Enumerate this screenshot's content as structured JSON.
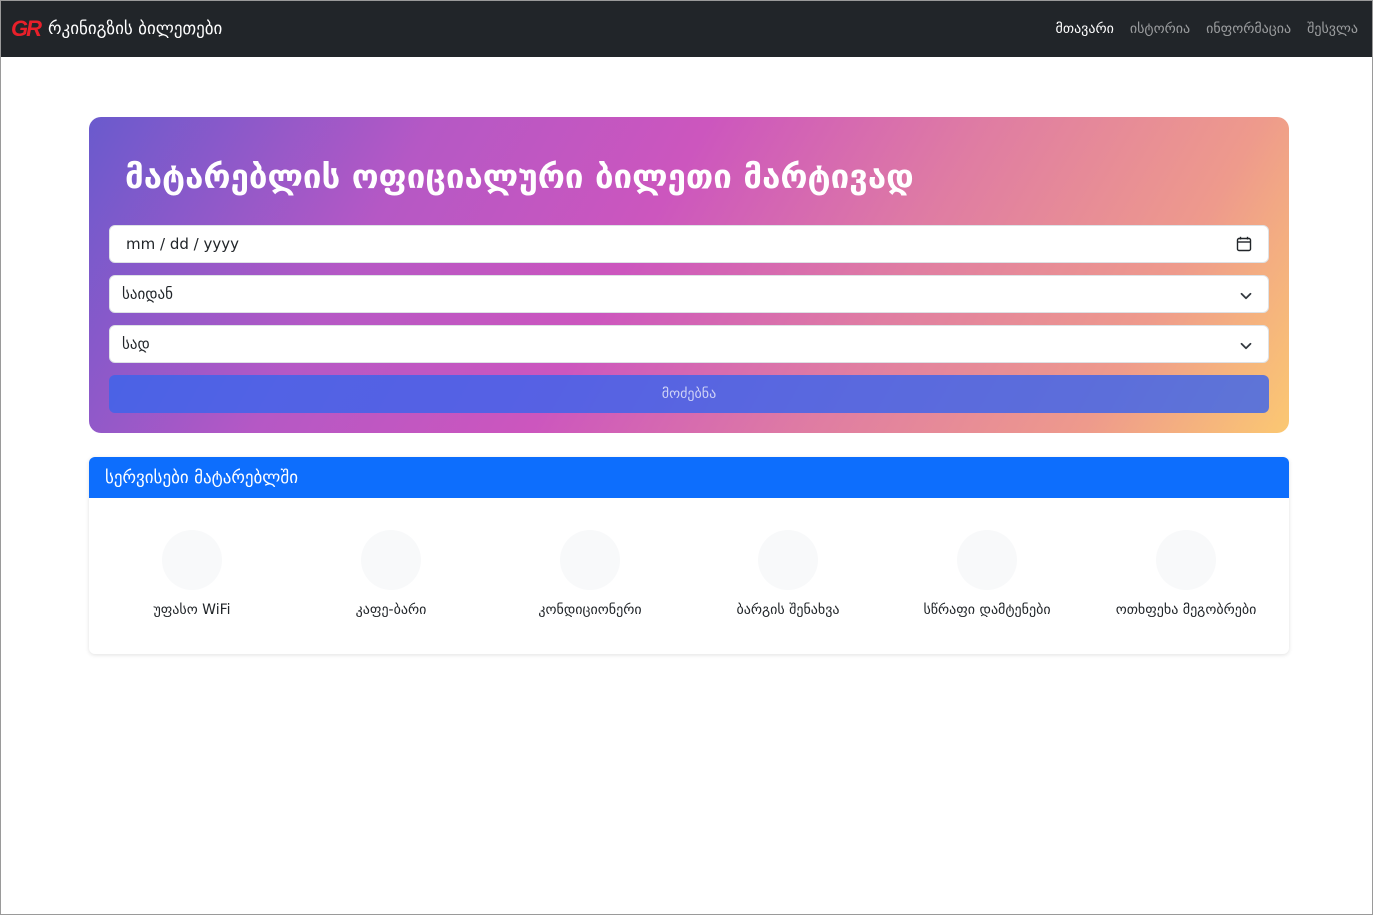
{
  "navbar": {
    "logo": "GR",
    "title": "რკინიგზის ბილეთები",
    "links": [
      "მთავარი",
      "ისტორია",
      "ინფორმაცია",
      "შესვლა"
    ]
  },
  "hero": {
    "title": "მატარებლის ოფიციალური ბილეთი მარტივად",
    "date_placeholder": "mm / dd / yyyy",
    "from_placeholder": "საიდან",
    "to_placeholder": "სად",
    "search_label": "მოძებნა"
  },
  "services": {
    "header": "სერვისები მატარებლში",
    "items": [
      "უფასო WiFi",
      "კაფე-ბარი",
      "კონდიციონერი",
      "ბარგის შენახვა",
      "სწრაფი დამტენები",
      "ოთხფეხა მეგობრები"
    ]
  },
  "colors": {
    "navbar_bg": "#212529",
    "logo_red": "#e8202a",
    "card_header_blue": "#0d6efd"
  }
}
